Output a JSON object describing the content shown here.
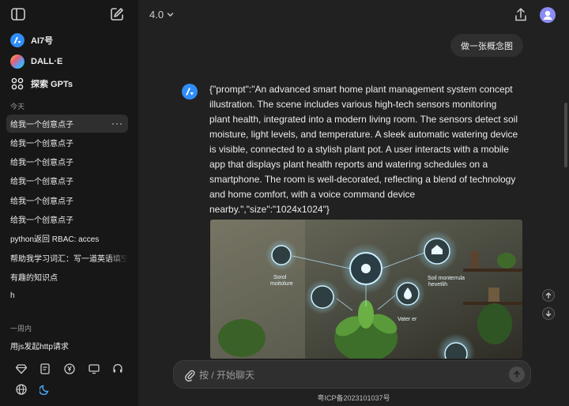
{
  "sidebar": {
    "apps": [
      {
        "label": "AI7号",
        "icon": "ai7-logo-icon",
        "color": "#2f8df7"
      },
      {
        "label": "DALL·E",
        "icon": "dalle-logo-icon"
      },
      {
        "label": "探索 GPTs",
        "icon": "grid-icon"
      }
    ],
    "section_today": "今天",
    "today_items": [
      "给我一个创意点子",
      "给我一个创意点子",
      "给我一个创意点子",
      "给我一个创意点子",
      "给我一个创意点子",
      "给我一个创意点子",
      "python返回 RBAC: acces",
      "帮助我学习词汇：写一道英语填空",
      "有趣的知识点",
      "h"
    ],
    "more_label": "···",
    "section_week": "一周内",
    "week_items": [
      "用js发起http请求"
    ],
    "bottom_icons": [
      "diamond-icon",
      "document-icon",
      "yen-icon",
      "monitor-icon",
      "headset-icon",
      "globe-icon",
      "moon-icon"
    ]
  },
  "header": {
    "model_label": "4.0",
    "chevron": "chevron-down-icon"
  },
  "chat": {
    "user_message": "做一张概念图",
    "bot_message": "{\"prompt\":\"An advanced smart home plant management system concept illustration. The scene includes various high-tech sensors monitoring plant health, integrated into a modern living room. The sensors detect soil moisture, light levels, and temperature. A sleek automatic watering device is visible, connected to a stylish plant pot. A user interacts with a mobile app that displays plant health reports and watering schedules on a smartphone. The room is well-decorated, reflecting a blend of technology and home comfort, with a voice command device nearby.\",\"size\":\"1024x1024\"}",
    "image_labels": {
      "soil": "Sorol",
      "moisture": "moitolure",
      "monitor": "Soil monterrula",
      "health": "hevetlih",
      "water": "Vater er"
    }
  },
  "composer": {
    "placeholder": "按 / 开始聊天"
  },
  "footer": {
    "icp": "粤ICP备2023101037号"
  },
  "colors": {
    "accent": "#2f8df7",
    "avatar": "#8b8cf5",
    "sidebar_bg": "#171717",
    "main_bg": "#212121"
  }
}
